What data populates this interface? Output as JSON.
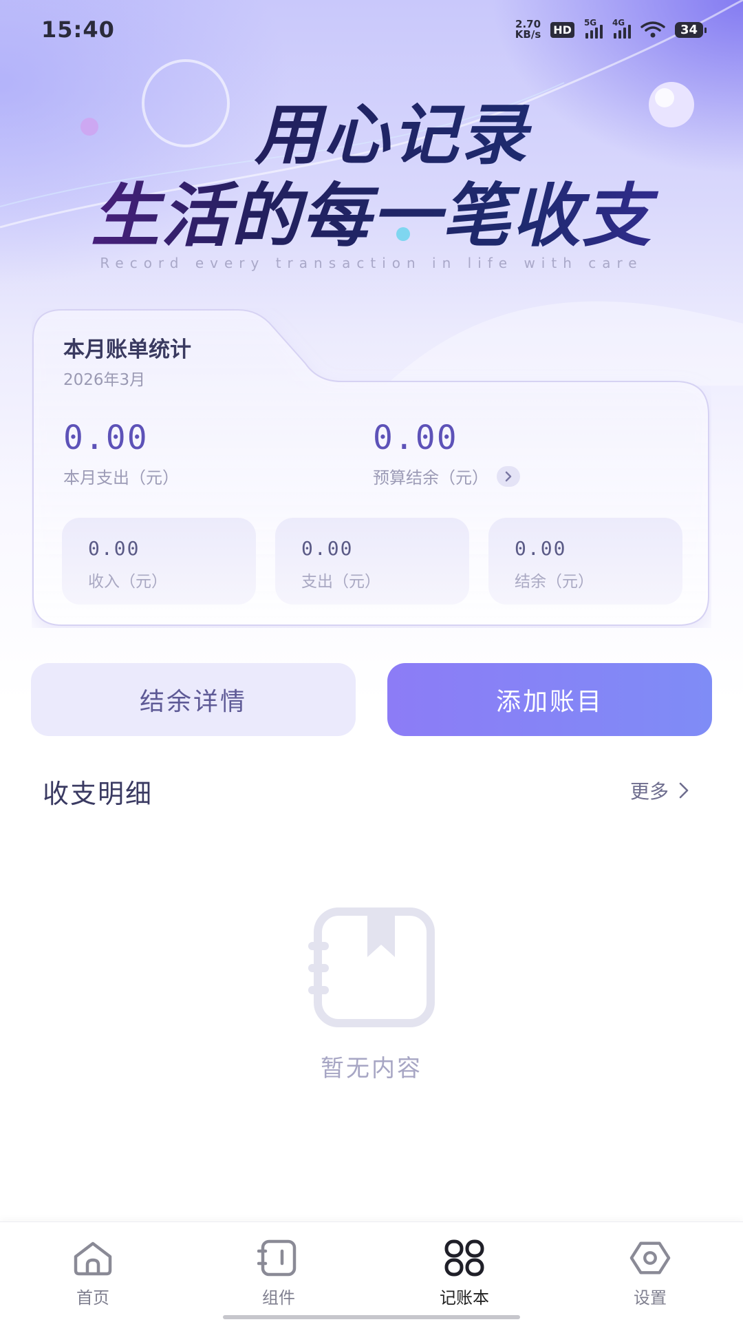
{
  "status_bar": {
    "time": "15:40",
    "net_speed_value": "2.70",
    "net_speed_unit": "KB/s",
    "hd_label": "HD",
    "signal_1_label": "5G",
    "signal_2_label": "4G",
    "battery_level": "34"
  },
  "hero": {
    "title_line1": "用心记录",
    "title_line2": "生活的每一笔收支",
    "subtitle": "Record every transaction in life with care"
  },
  "stats_card": {
    "title": "本月账单统计",
    "date": "2026年3月",
    "expense_value": "0.00",
    "expense_label": "本月支出（元）",
    "budget_value": "0.00",
    "budget_label": "预算结余（元）",
    "mini": [
      {
        "value": "0.00",
        "label": "收入（元）"
      },
      {
        "value": "0.00",
        "label": "支出（元）"
      },
      {
        "value": "0.00",
        "label": "结余（元）"
      }
    ]
  },
  "actions": {
    "balance_details": "结余详情",
    "add_entry": "添加账目"
  },
  "details": {
    "title": "收支明细",
    "more": "更多",
    "empty_text": "暂无内容"
  },
  "bottom_nav": {
    "items": [
      {
        "label": "首页",
        "icon": "home-icon"
      },
      {
        "label": "组件",
        "icon": "widget-icon"
      },
      {
        "label": "记账本",
        "icon": "ledger-grid-icon"
      },
      {
        "label": "设置",
        "icon": "settings-icon"
      }
    ],
    "active_index": 2
  },
  "colors": {
    "accent": "#8c7cf6",
    "value_purple": "#5d52b8",
    "soft_purple_bg": "#ebeafc"
  }
}
